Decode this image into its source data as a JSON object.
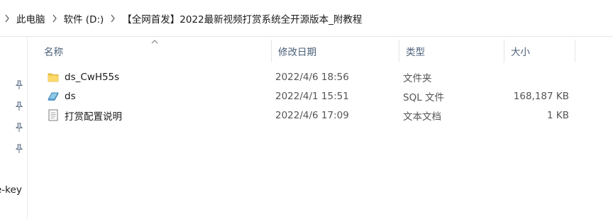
{
  "breadcrumb": {
    "items": [
      "此电脑",
      "软件 (D:)",
      "【全网首发】2022最新视频打赏系统全开源版本_附教程"
    ]
  },
  "columns": {
    "name": "名称",
    "date": "修改日期",
    "type": "类型",
    "size": "大小"
  },
  "files": [
    {
      "name": "ds_CwH55s",
      "date": "2022/4/6 18:56",
      "type": "文件夹",
      "size": "",
      "icon": "folder-icon"
    },
    {
      "name": "ds",
      "date": "2022/4/1 15:51",
      "type": "SQL 文件",
      "size": "168,187 KB",
      "icon": "sql-file-icon"
    },
    {
      "name": "打赏配置说明",
      "date": "2022/4/6 17:09",
      "type": "文本文档",
      "size": "1 KB",
      "icon": "text-file-icon"
    }
  ],
  "sidebar": {
    "cut_text": "e-key"
  }
}
